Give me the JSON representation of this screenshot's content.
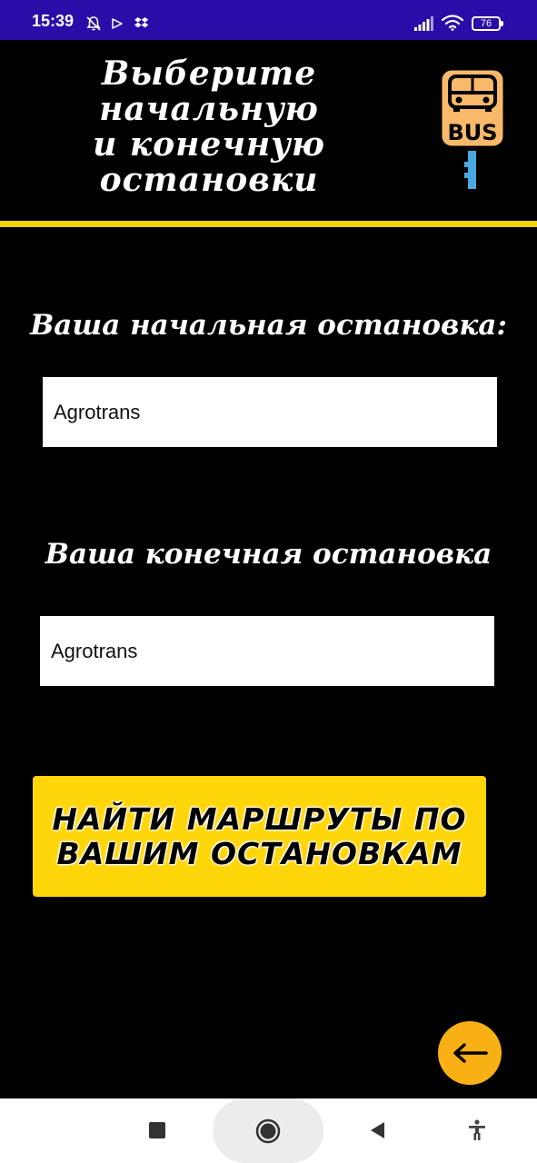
{
  "status_bar": {
    "time": "15:39",
    "battery": "76",
    "icons": [
      "notifications-off-icon",
      "play-store-icon",
      "dropbox-icon",
      "signal-icon",
      "wifi-icon",
      "battery-icon"
    ]
  },
  "header": {
    "title": "Выберите\nначальную\nи конечную\nостановки",
    "logo_icon": "bus-stop-icon",
    "logo_text": "BUS"
  },
  "start_stop": {
    "label": "Ваша начальная остановка:",
    "value": "Agrotrans"
  },
  "end_stop": {
    "label": "Ваша конечная остановка",
    "value": "Agrotrans"
  },
  "find_button": {
    "label": "НАЙТИ МАРШРУТЫ ПО ВАШИМ ОСТАНОВКАМ"
  },
  "back_fab": {
    "icon": "arrow-left-icon"
  },
  "nav_bar": {
    "icons": [
      "recents-square-icon",
      "home-circle-icon",
      "back-triangle-icon",
      "accessibility-icon"
    ]
  },
  "colors": {
    "background": "#000000",
    "status_bar": "#2a0ca8",
    "accent_yellow": "#ffd60a",
    "divider_yellow": "#f5d30a",
    "fab_orange": "#f9b015",
    "logo_orange": "#f9b96a"
  }
}
